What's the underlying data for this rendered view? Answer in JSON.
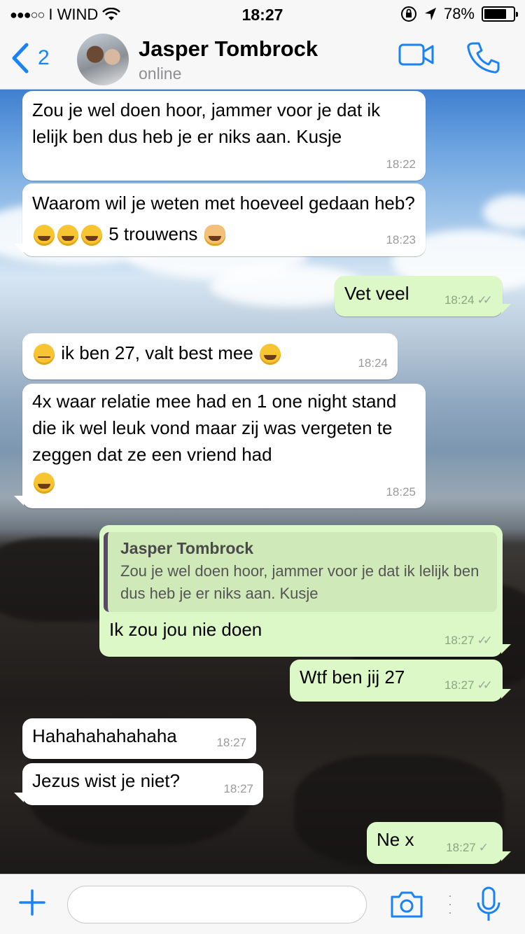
{
  "status_bar": {
    "signal": "●●●○○",
    "carrier": "I WIND",
    "time": "18:27",
    "battery": "78%",
    "battery_level": 0.78
  },
  "header": {
    "back_count": "2",
    "contact_name": "Jasper Tombrock",
    "contact_status": "online"
  },
  "colors": {
    "accent": "#1a82f7",
    "incoming_bubble": "#ffffff",
    "outgoing_bubble": "#dcf8c6"
  },
  "messages": {
    "m1": {
      "text": "Zou je wel doen hoor, jammer voor je dat ik lelijk ben dus heb je er niks aan. Kusje",
      "time": "18:22"
    },
    "m2": {
      "text_a": "Waarom wil je weten met hoeveel gedaan heb?",
      "text_b": "5 trouwens",
      "time": "18:23"
    },
    "m3": {
      "text": "Vet veel",
      "time": "18:24"
    },
    "m4": {
      "text": "ik ben 27, valt best mee",
      "time": "18:24"
    },
    "m5": {
      "text": "4x waar relatie mee had en 1 one night stand die ik wel leuk vond maar zij was vergeten te zeggen dat ze een vriend had",
      "time": "18:25"
    },
    "m6": {
      "quote_name": "Jasper Tombrock",
      "quote_text": "Zou je wel doen hoor, jammer voor je dat ik lelijk ben dus heb je er niks aan. Kusje",
      "text": "Ik zou jou nie doen",
      "time": "18:27"
    },
    "m7": {
      "text": "Wtf ben jij 27",
      "time": "18:27"
    },
    "m8": {
      "text": "Hahahahahahaha",
      "time": "18:27"
    },
    "m9": {
      "text": "Jezus wist je niet?",
      "time": "18:27"
    },
    "m10": {
      "text": "Ne x",
      "time": "18:27"
    }
  },
  "icons": {
    "back": "chevron-left-icon",
    "video": "video-camera-icon",
    "call": "phone-icon",
    "attach": "plus-icon",
    "camera": "camera-icon",
    "mic": "microphone-icon"
  }
}
